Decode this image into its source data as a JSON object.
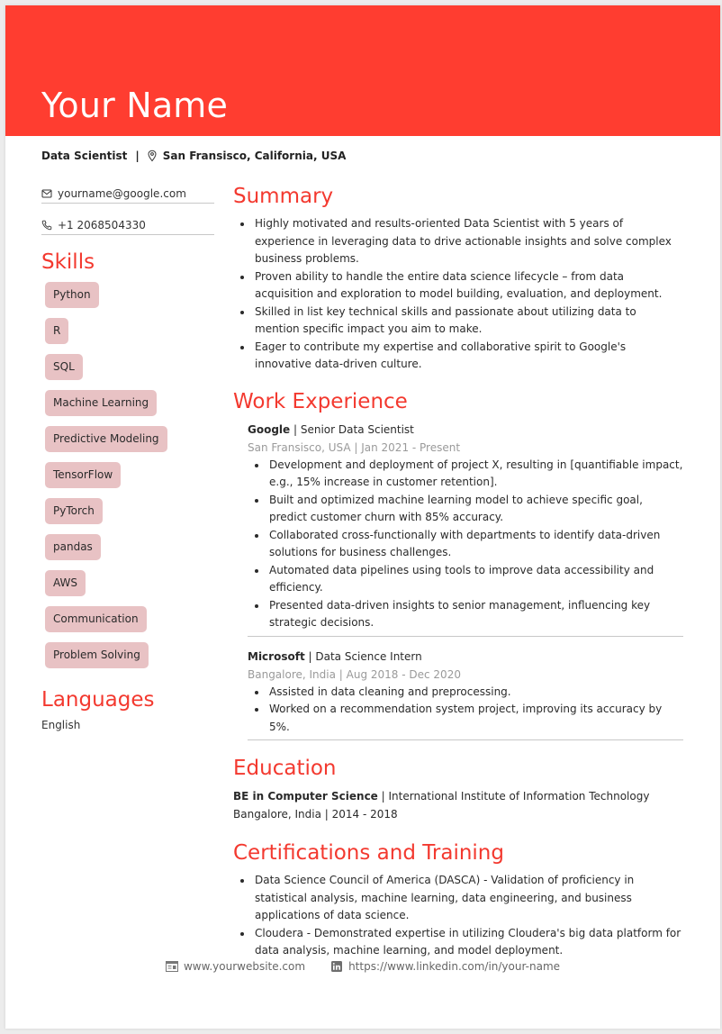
{
  "header": {
    "name": "Your Name",
    "title": "Data Scientist",
    "separator": "|",
    "location": "San Fransisco, California, USA",
    "accent_color": "#ff3d30"
  },
  "contact": {
    "email": "yourname@google.com",
    "phone": "+1 2068504330"
  },
  "skills": {
    "heading": "Skills",
    "items": [
      "Python",
      "R",
      "SQL",
      "Machine Learning",
      "Predictive Modeling",
      "TensorFlow",
      "PyTorch",
      "pandas",
      "AWS",
      "Communication",
      "Problem Solving"
    ]
  },
  "languages": {
    "heading": "Languages",
    "items": [
      "English"
    ]
  },
  "summary": {
    "heading": "Summary",
    "bullets": [
      "Highly motivated and results-oriented Data Scientist with 5 years of experience in leveraging data to drive actionable insights and solve complex business problems.",
      "Proven ability to handle the entire data science lifecycle – from data acquisition and exploration to model building, evaluation, and deployment.",
      "Skilled in list key technical skills and passionate about utilizing data to mention specific impact you aim to make.",
      "Eager to contribute my expertise and collaborative spirit to Google's innovative data-driven culture."
    ]
  },
  "work": {
    "heading": "Work Experience",
    "jobs": [
      {
        "company": "Google",
        "role": " | Senior Data Scientist",
        "meta": "San Fransisco, USA | Jan 2021 - Present",
        "bullets": [
          "Development and deployment of project X, resulting in [quantifiable impact, e.g., 15% increase in customer retention].",
          "Built and optimized machine learning model to achieve specific goal, predict customer churn with 85% accuracy.",
          "Collaborated cross-functionally with departments to identify data-driven solutions for business challenges.",
          "Automated data pipelines using tools to improve data accessibility and efficiency.",
          "Presented data-driven insights to senior management, influencing key strategic decisions."
        ]
      },
      {
        "company": "Microsoft",
        "role": " | Data Science Intern",
        "meta": "Bangalore, India | Aug 2018 - Dec 2020",
        "bullets": [
          "Assisted in data cleaning and preprocessing.",
          "Worked on a recommendation system project, improving its accuracy by 5%."
        ]
      }
    ]
  },
  "education": {
    "heading": "Education",
    "degree": "BE in Computer Science",
    "institution": " | International Institute of Information Technology",
    "meta": "Bangalore, India | 2014 - 2018"
  },
  "certifications": {
    "heading": "Certifications and Training",
    "bullets": [
      "Data Science Council of America (DASCA) - Validation of proficiency in statistical analysis, machine learning, data engineering, and business applications of data science.",
      "Cloudera - Demonstrated expertise in utilizing Cloudera's big data platform for data analysis, machine learning, and model deployment."
    ]
  },
  "footer": {
    "website": "www.yourwebsite.com",
    "linkedin": "https://www.linkedin.com/in/your-name"
  }
}
